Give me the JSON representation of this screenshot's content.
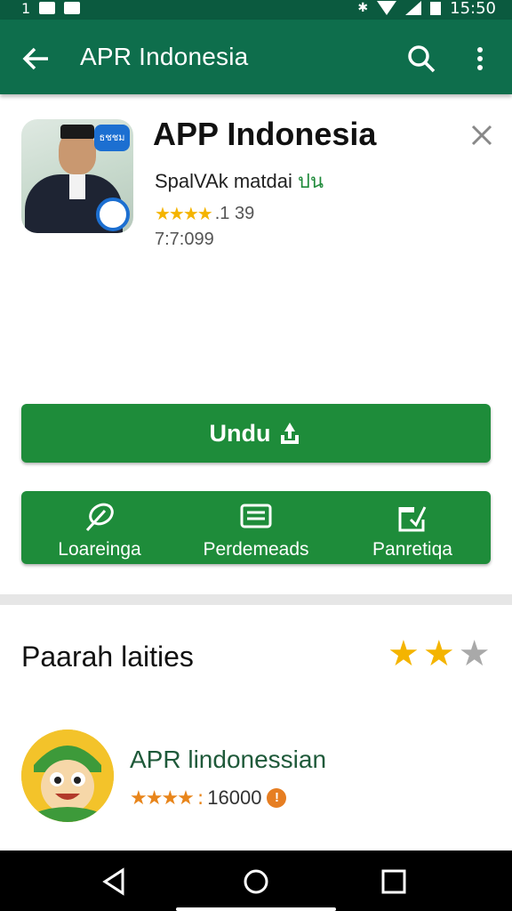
{
  "status_bar": {
    "time": "15:50"
  },
  "toolbar": {
    "title": "APR Indonesia"
  },
  "app": {
    "name": "APP Indonesia",
    "developer": "SpalVAk matdai",
    "developer_tag": "ปน",
    "rating_text": ".1 39",
    "date_text": "7:7:099",
    "icon_badge_text": "ธชชม"
  },
  "install_button": {
    "label": "Undu"
  },
  "actions": [
    {
      "label": "Loareinga",
      "icon": "leaf-icon"
    },
    {
      "label": "Perdemeads",
      "icon": "chat-icon"
    },
    {
      "label": "Panretiqa",
      "icon": "share-icon"
    }
  ],
  "section": {
    "title": "Paarah laities",
    "stars_on": 2,
    "stars_total": 3
  },
  "list_item": {
    "title": "APR lindonessian",
    "rating_text": "16000",
    "badge": "!"
  },
  "colors": {
    "toolbar": "#0e6e4c",
    "status_bar": "#0b5a3f",
    "primary_green": "#1e8c3a",
    "star": "#f4b400"
  }
}
